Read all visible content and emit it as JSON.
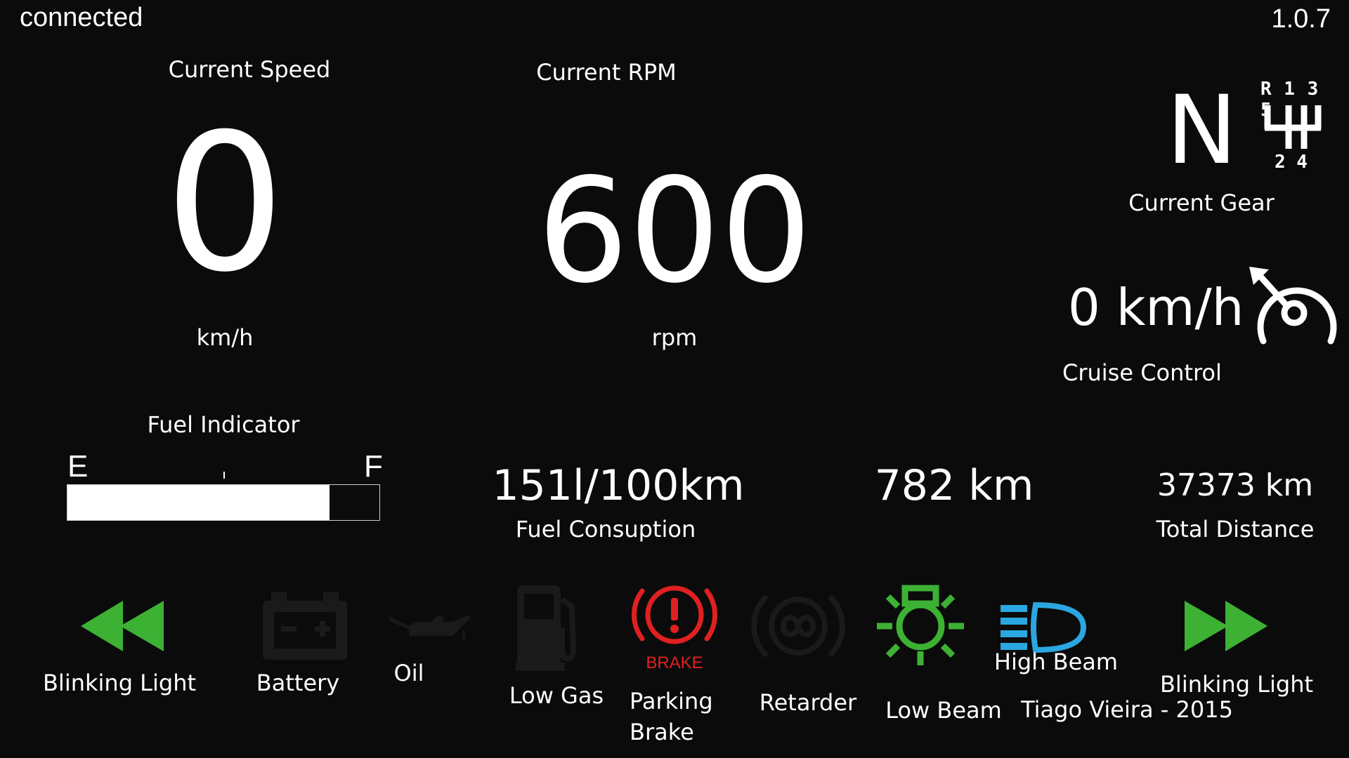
{
  "status": {
    "connection": "connected",
    "version": "1.0.7"
  },
  "speed": {
    "title": "Current Speed",
    "value": "0",
    "unit": "km/h"
  },
  "rpm": {
    "title": "Current RPM",
    "value": "600",
    "unit": "rpm"
  },
  "gear": {
    "value": "N",
    "label": "Current Gear",
    "shift_top": "R 1 3 5",
    "shift_bottom": "2 4",
    "shift-icon": "gear-shift-pattern-icon"
  },
  "cruise": {
    "value": "0 km/h",
    "label": "Cruise Control",
    "icon": "cruise-control-icon"
  },
  "fuel": {
    "title": "Fuel Indicator",
    "empty_label": "E",
    "full_label": "F",
    "level": 0.84
  },
  "consumption": {
    "value": "151l/100km",
    "label": "Fuel Consuption"
  },
  "range": {
    "value": "782 km"
  },
  "odometer": {
    "value": "37373 km",
    "label": "Total Distance"
  },
  "indicators": {
    "blink_left": {
      "label": "Blinking Light",
      "icon": "blink-left-icon",
      "color": "#3db134",
      "active": true
    },
    "battery": {
      "label": "Battery",
      "icon": "battery-icon",
      "color": "#1a1a1a",
      "active": false
    },
    "oil": {
      "label": "Oil",
      "icon": "oil-can-icon",
      "color": "#1a1a1a",
      "active": false
    },
    "low_gas": {
      "label": "Low Gas",
      "icon": "fuel-pump-icon",
      "color": "#1a1a1a",
      "active": false
    },
    "parking_brake": {
      "label_line1": "Parking",
      "label_line2": "Brake",
      "icon": "brake-warning-icon",
      "icon_text": "BRAKE",
      "color": "#e02020",
      "active": true
    },
    "retarder": {
      "label": "Retarder",
      "icon": "retarder-icon",
      "color": "#1a1a1a",
      "active": false
    },
    "low_beam": {
      "label": "Low Beam",
      "icon": "low-beam-icon",
      "color": "#3db134",
      "active": true
    },
    "high_beam": {
      "label": "High Beam",
      "icon": "high-beam-icon",
      "color": "#2aa6e0",
      "active": true
    },
    "blink_right": {
      "label": "Blinking Light",
      "icon": "blink-right-icon",
      "color": "#3db134",
      "active": true
    }
  },
  "credit": "Tiago Vieira - 2015"
}
